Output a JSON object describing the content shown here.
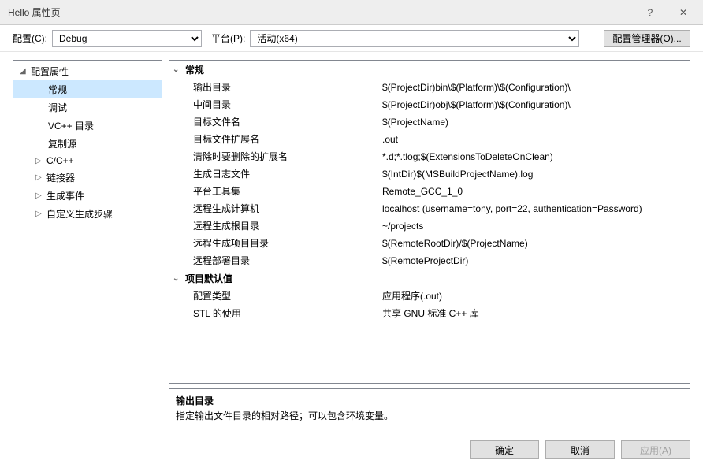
{
  "window": {
    "title": "Hello 属性页",
    "help_symbol": "?",
    "close_symbol": "✕"
  },
  "toolbar": {
    "config_label": "配置(C):",
    "config_value": "Debug",
    "platform_label": "平台(P):",
    "platform_value": "活动(x64)",
    "configmgr_label": "配置管理器(O)..."
  },
  "sidebar": {
    "root": "配置属性",
    "items": {
      "general": "常规",
      "debug": "调试",
      "vcdirs": "VC++ 目录",
      "copysrc": "复制源",
      "cpp": "C/C++",
      "linker": "链接器",
      "buildevents": "生成事件",
      "custombuild": "自定义生成步骤"
    }
  },
  "groups": {
    "general": "常规",
    "defaults": "项目默认值"
  },
  "props": {
    "outdir": {
      "name": "输出目录",
      "value": "$(ProjectDir)bin\\$(Platform)\\$(Configuration)\\"
    },
    "intdir": {
      "name": "中间目录",
      "value": "$(ProjectDir)obj\\$(Platform)\\$(Configuration)\\"
    },
    "targetname": {
      "name": "目标文件名",
      "value": "$(ProjectName)"
    },
    "targetext": {
      "name": "目标文件扩展名",
      "value": ".out"
    },
    "cleanext": {
      "name": "清除时要删除的扩展名",
      "value": "*.d;*.tlog;$(ExtensionsToDeleteOnClean)"
    },
    "buildlog": {
      "name": "生成日志文件",
      "value": "$(IntDir)$(MSBuildProjectName).log"
    },
    "toolset": {
      "name": "平台工具集",
      "value": "Remote_GCC_1_0"
    },
    "remotemachine": {
      "name": "远程生成计算机",
      "value": "localhost (username=tony, port=22, authentication=Password)"
    },
    "remoteroot": {
      "name": "远程生成根目录",
      "value": "~/projects"
    },
    "remoteproj": {
      "name": "远程生成项目目录",
      "value": "$(RemoteRootDir)/$(ProjectName)"
    },
    "remotedeploy": {
      "name": "远程部署目录",
      "value": "$(RemoteProjectDir)"
    },
    "configtype": {
      "name": "配置类型",
      "value": "应用程序(.out)"
    },
    "stl": {
      "name": "STL 的使用",
      "value": "共享 GNU 标准 C++ 库"
    }
  },
  "description": {
    "name": "输出目录",
    "text": "指定输出文件目录的相对路径；可以包含环境变量。"
  },
  "footer": {
    "ok": "确定",
    "cancel": "取消",
    "apply": "应用(A)"
  }
}
